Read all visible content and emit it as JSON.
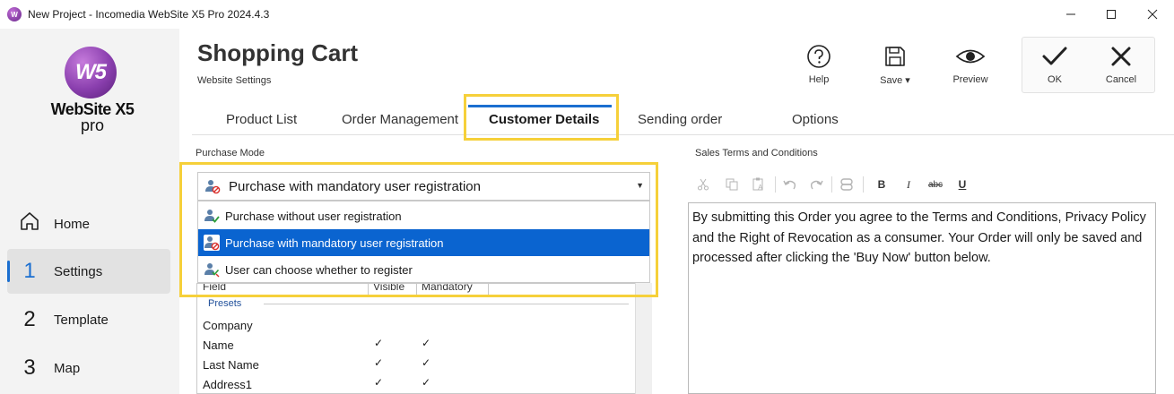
{
  "window": {
    "title": "New Project - Incomedia WebSite X5 Pro 2024.4.3",
    "controls": [
      "minimize-icon",
      "maximize-icon",
      "close-icon"
    ]
  },
  "logo": {
    "mark": "W5",
    "name": "WebSite X5",
    "edition": "pro",
    "brand_color": "#8a3fae"
  },
  "sidebar": {
    "items": [
      {
        "number": "",
        "label": "Home",
        "icon": "home-icon",
        "active": false
      },
      {
        "number": "1",
        "label": "Settings",
        "active": true
      },
      {
        "number": "2",
        "label": "Template",
        "active": false
      },
      {
        "number": "3",
        "label": "Map",
        "active": false
      }
    ]
  },
  "header": {
    "title": "Shopping Cart",
    "subtitle": "Website Settings"
  },
  "toolbar": {
    "help": "Help",
    "save": "Save",
    "preview": "Preview",
    "ok": "OK",
    "cancel": "Cancel"
  },
  "tabs": [
    {
      "label": "Product List",
      "active": false
    },
    {
      "label": "Order Management",
      "active": false
    },
    {
      "label": "Customer Details",
      "active": true
    },
    {
      "label": "Sending order",
      "active": false
    },
    {
      "label": "Options",
      "active": false
    }
  ],
  "purchase_mode": {
    "label": "Purchase Mode",
    "selected": "Purchase with mandatory user registration",
    "options": [
      {
        "label": "Purchase without user registration",
        "icon": "user-check-icon",
        "selected": false
      },
      {
        "label": "Purchase with mandatory user registration",
        "icon": "user-blocked-icon",
        "selected": true
      },
      {
        "label": "User can choose whether to register",
        "icon": "user-choice-icon",
        "selected": false
      }
    ]
  },
  "fields_table": {
    "columns": [
      "Field",
      "Visible",
      "Mandatory"
    ],
    "group": "Presets",
    "check": "✓",
    "rows": [
      {
        "name": "Company",
        "visible": false,
        "mandatory": false
      },
      {
        "name": "Name",
        "visible": true,
        "mandatory": true
      },
      {
        "name": "Last Name",
        "visible": true,
        "mandatory": true
      },
      {
        "name": "Address1",
        "visible": true,
        "mandatory": true
      }
    ]
  },
  "sales_terms": {
    "label": "Sales Terms and Conditions",
    "editor_tools": {
      "bold": "B",
      "italic": "I",
      "strike": "abc",
      "underline": "U"
    },
    "text": "By submitting this Order you agree to the Terms and Conditions, Privacy Policy and the Right of Revocation as a consumer. Your Order will only be saved and processed after clicking the 'Buy Now' button below."
  },
  "colors": {
    "accent": "#1b6fd0",
    "highlight": "#f6d03a",
    "selection": "#0a64d0"
  }
}
